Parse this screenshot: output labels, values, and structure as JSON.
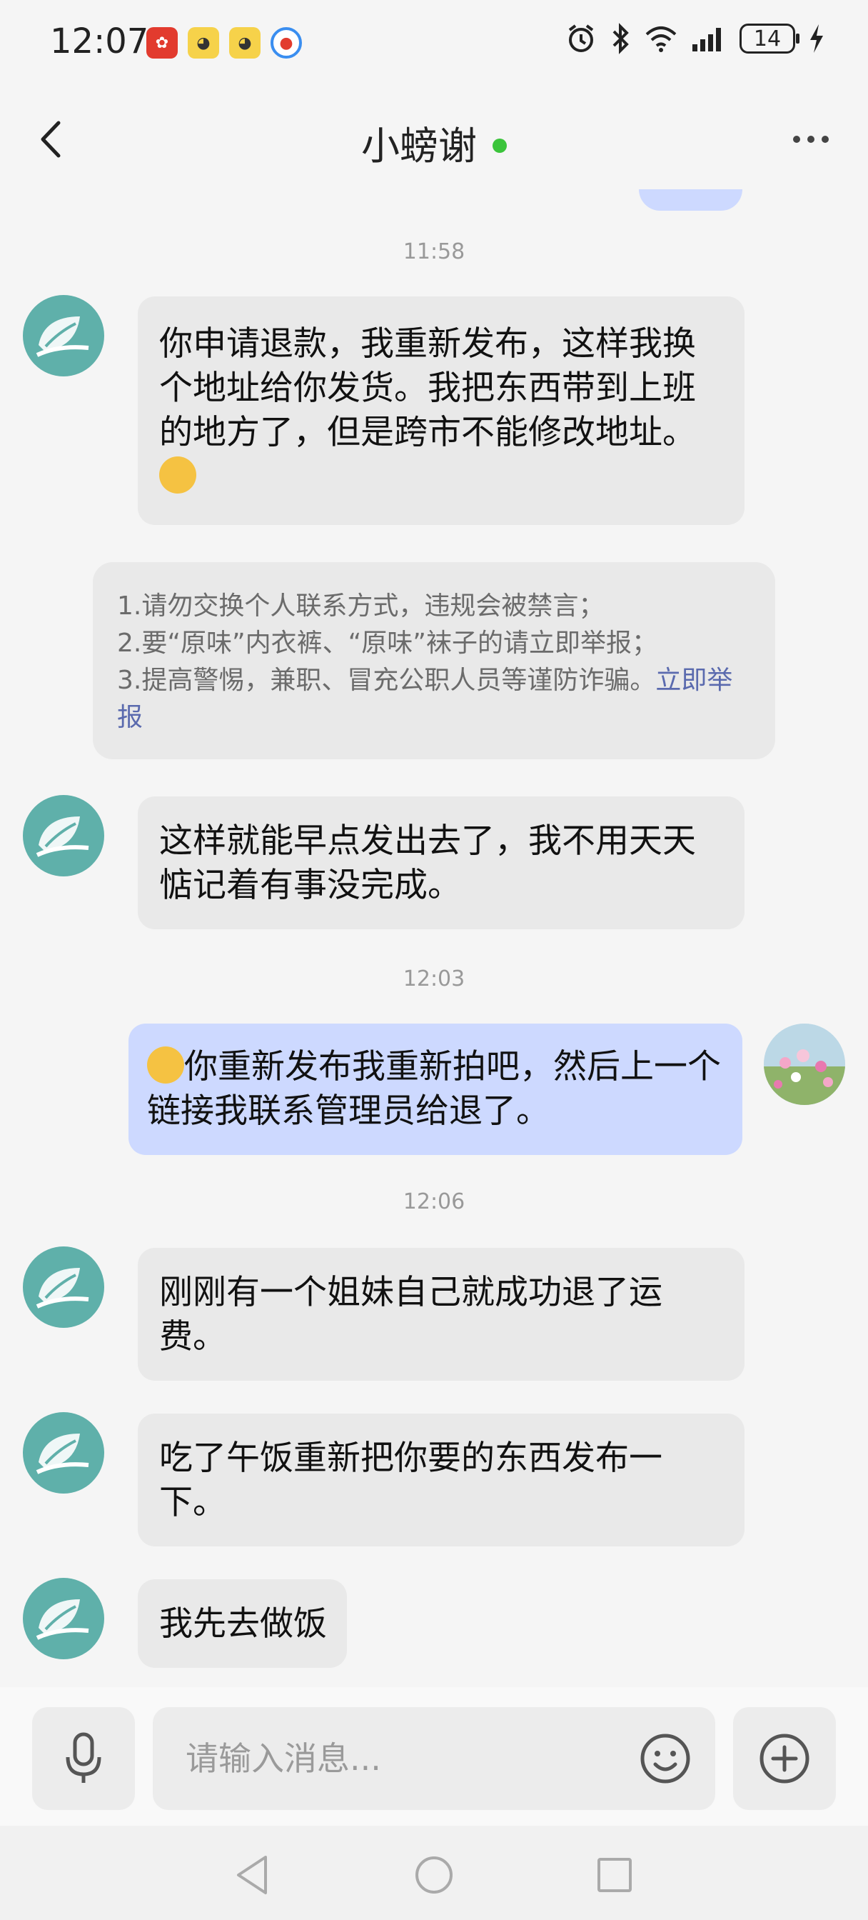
{
  "status_bar": {
    "time": "12:07",
    "battery": "14"
  },
  "header": {
    "title": "小螃谢",
    "online_color": "#3bc43b"
  },
  "messages": [
    {
      "type": "timestamp",
      "text": "11:58"
    },
    {
      "type": "incoming",
      "text": "你申请退款，我重新发布，这样我换个地址给你发货。我把东西带到上班的地方了，但是跨市不能修改地址。"
    },
    {
      "type": "notice",
      "lines": [
        "1.请勿交换个人联系方式，违规会被禁言；",
        "2.要“原味”内衣裤、“原味”袜子的请立即举报；",
        "3.提高警惕，兼职、冒充公职人员等谨防诈骗。"
      ],
      "link": "立即举报"
    },
    {
      "type": "incoming",
      "text": "这样就能早点发出去了，我不用天天惦记着有事没完成。"
    },
    {
      "type": "timestamp",
      "text": "12:03"
    },
    {
      "type": "outgoing",
      "text": "你重新发布我重新拍吧，然后上一个链接我联系管理员给退了。"
    },
    {
      "type": "timestamp",
      "text": "12:06"
    },
    {
      "type": "incoming",
      "text": "刚刚有一个姐妹自己就成功退了运费。"
    },
    {
      "type": "incoming",
      "text": "吃了午饭重新把你要的东西发布一下。"
    },
    {
      "type": "incoming",
      "text": "我先去做饭"
    }
  ],
  "input": {
    "placeholder": "请输入消息..."
  },
  "colors": {
    "incoming_bubble": "#e9e9e9",
    "outgoing_bubble": "#cdd9ff",
    "avatar": "#5fb0aa",
    "link": "#5a6aae"
  }
}
